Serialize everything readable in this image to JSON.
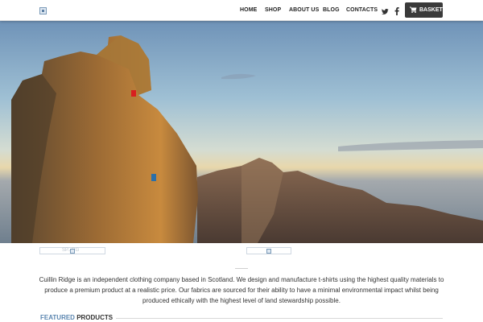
{
  "nav": {
    "links": [
      "HOME",
      "SHOP",
      "ABOUT US",
      "BLOG",
      "CONTACTS"
    ],
    "basket_label": "BASKET",
    "social": [
      "twitter-icon",
      "facebook-icon"
    ]
  },
  "features": {
    "left_alt": "SP...RG"
  },
  "intro": {
    "text": "Cuillin Ridge is an independent clothing company based in Scotland. We design and manufacture t-shirts using the highest quality materials to produce a premium product at a realistic price. Our fabrics are sourced for their ability to have a minimal environmental impact whilst being produced ethically with the highest level of land stewardship possible."
  },
  "section": {
    "title_accent": "FEATURED",
    "title_rest": " PRODUCTS"
  },
  "colors": {
    "accent": "#5b86b0",
    "basket_bg": "#3a3a3a"
  }
}
